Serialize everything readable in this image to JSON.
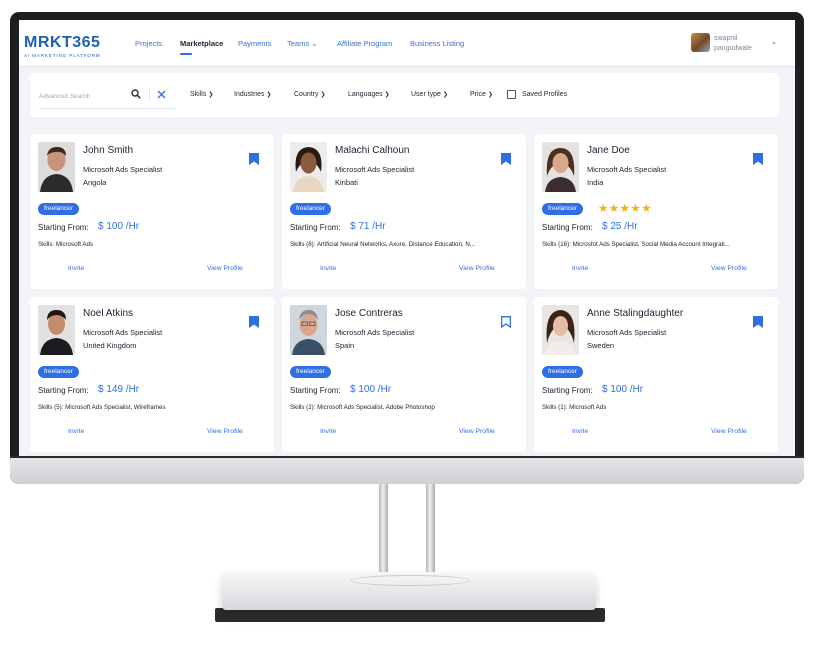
{
  "brand": {
    "logo": "MRKT365",
    "tagline": "AI MARKETING PLATFORM",
    "accent": "#2f6fe6"
  },
  "nav": {
    "items": [
      "Projects",
      "Marketplace",
      "Payments",
      "Teams",
      "Affiliate Program",
      "Business Listing"
    ],
    "active": "Marketplace"
  },
  "user": {
    "first": "swapnil",
    "last": "pangudwale"
  },
  "search": {
    "placeholder": "Advanced Search",
    "value": ""
  },
  "filters": [
    "Skills",
    "Industries",
    "Country",
    "Languages",
    "User type",
    "Price"
  ],
  "saved_profiles": {
    "label": "Saved Profiles",
    "checked": false
  },
  "profiles": [
    {
      "name": "John Smith",
      "role": "Microsoft Ads Specialist",
      "country": "Angola",
      "badge": "freelancer",
      "rating": 0,
      "price_label": "Starting From:",
      "price": "$ 100 /Hr",
      "skills": "Skills: Microsoft Ads",
      "bookmarked": true,
      "invite": "Invite",
      "view": "View Profile"
    },
    {
      "name": "Malachi Calhoun",
      "role": "Microsoft Ads Specialist",
      "country": "Kiribati",
      "badge": "freelancer",
      "rating": 0,
      "price_label": "Starting From:",
      "price": "$ 71 /Hr",
      "skills": "Skills (8): Artificial Neural Networks, Axure, Distance Education, N...",
      "bookmarked": true,
      "invite": "Invite",
      "view": "View Profile"
    },
    {
      "name": "Jane Doe",
      "role": "Microsoft Ads Specialist",
      "country": "India",
      "badge": "freelancer",
      "rating": 5,
      "stars": "★★★★★",
      "price_label": "Starting From:",
      "price": "$ 25 /Hr",
      "skills": "Skills (16): Microsfot Ads Specialist, Social Media Account Integrati...",
      "bookmarked": true,
      "invite": "Invite",
      "view": "View Profile"
    },
    {
      "name": "Noel Atkins",
      "role": "Microsoft Ads Specialist",
      "country": "United Kingdom",
      "badge": "freelancer",
      "rating": 0,
      "price_label": "Starting From:",
      "price": "$ 149 /Hr",
      "skills": "Skills (5): Microsoft Ads Specialist, Wireframes",
      "bookmarked": true,
      "invite": "Invite",
      "view": "View Profile"
    },
    {
      "name": "Jose Contreras",
      "role": "Microsoft Ads Specialist",
      "country": "Spain",
      "badge": "freelancer",
      "rating": 0,
      "price_label": "Starting From:",
      "price": "$ 100 /Hr",
      "skills": "Skills (2): Microsoft Ads Specialist, Adobe Photoshop",
      "bookmarked": false,
      "invite": "Invite",
      "view": "View Profile"
    },
    {
      "name": "Anne Stalingdaughter",
      "role": "Microsoft Ads Specialist",
      "country": "Sweden",
      "badge": "freelancer",
      "rating": 0,
      "price_label": "Starting From:",
      "price": "$ 100 /Hr",
      "skills": "Skills (1): Microsoft Ads",
      "bookmarked": true,
      "invite": "Invite",
      "view": "View Profile"
    }
  ]
}
